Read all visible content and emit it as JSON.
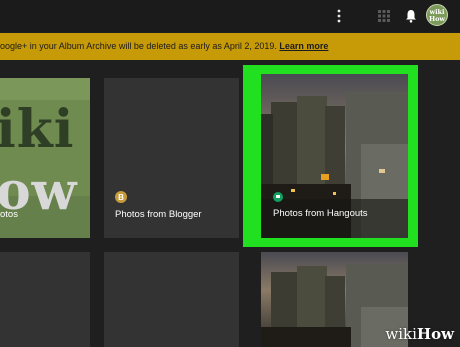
{
  "header": {
    "menu_icon": "vertical-dots-icon",
    "apps_icon": "grid-apps-icon",
    "notifications_icon": "bell-icon",
    "avatar_text": "wiki How"
  },
  "banner": {
    "text": "oogle+ in your Album Archive will be deleted as early as April 2, 2019. ",
    "link": "Learn more",
    "color": "#c79a08"
  },
  "albums": [
    {
      "label": "otos",
      "badge_icon": "",
      "badge_color": ""
    },
    {
      "label": "Photos from Blogger",
      "badge_icon": "blogger-icon",
      "badge_letter": "B",
      "badge_color": "#c79a3a"
    },
    {
      "label": "Photos from Hangouts",
      "badge_icon": "hangouts-icon",
      "badge_color": "#10a060"
    }
  ],
  "art_text": {
    "line1": "iki",
    "line2": "ow"
  },
  "accent": {
    "highlight": "#20e020"
  },
  "watermark": {
    "wiki": "wiki",
    "how": "How"
  }
}
